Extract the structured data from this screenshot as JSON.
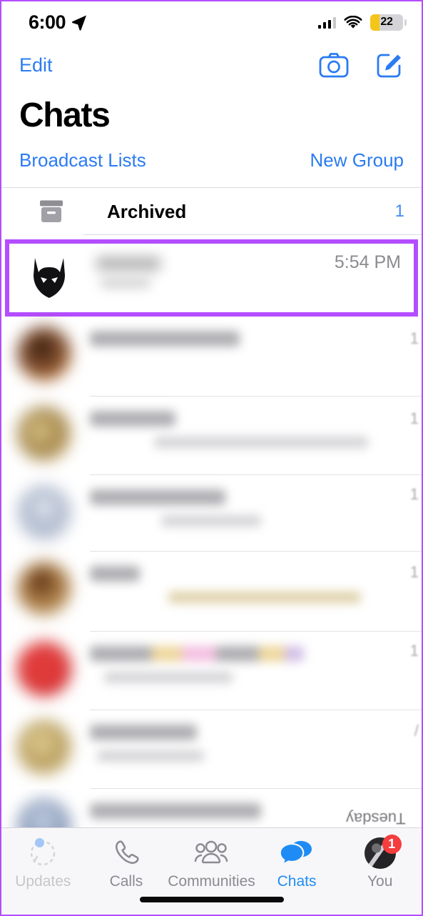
{
  "status_bar": {
    "time": "6:00",
    "location_icon": "location-arrow-icon",
    "signal_icon": "cellular-signal-icon",
    "wifi_icon": "wifi-icon",
    "battery_percent": "22",
    "battery_icon": "battery-low-power-icon"
  },
  "nav": {
    "edit_label": "Edit",
    "camera_icon": "camera-icon",
    "compose_icon": "compose-new-chat-icon"
  },
  "header": {
    "title": "Chats",
    "broadcast_lists_label": "Broadcast Lists",
    "new_group_label": "New Group"
  },
  "archived": {
    "icon": "archive-box-icon",
    "label": "Archived",
    "count": "1"
  },
  "highlighted_chat": {
    "avatar_icon": "batman-mask-avatar",
    "name": "",
    "message_preview": "",
    "timestamp": "5:54 PM",
    "highlight_color": "#b44dff"
  },
  "chat_rows": [
    {
      "avatar_color": "#7a4a2c",
      "name_width": 210,
      "line_widths": [
        0
      ],
      "badge": "1",
      "blurred": true
    },
    {
      "avatar_color": "#b79a62",
      "name_width": 120,
      "line_widths": [
        300
      ],
      "badge": "1",
      "blurred": true
    },
    {
      "avatar_color": "#a9b3c6",
      "name_width": 190,
      "line_widths": [
        140
      ],
      "badge": "1",
      "blurred": true
    },
    {
      "avatar_color": "#8a6038",
      "name_width": 70,
      "line_widths": [
        270
      ],
      "badge": "1",
      "blurred": true
    },
    {
      "avatar_color": "#d62b2b",
      "name_width": 300,
      "line_widths": [
        180
      ],
      "badge": "1",
      "blurred": true
    },
    {
      "avatar_color": "#c6ab6e",
      "name_width": 150,
      "line_widths": [
        150
      ],
      "badge": "",
      "blurred": true
    },
    {
      "avatar_color": "#8fa0bd",
      "name_width": 240,
      "line_widths": [
        0
      ],
      "badge": "",
      "blurred": true
    }
  ],
  "artifact_text": "Tuesday",
  "tab_bar": {
    "tabs": [
      {
        "label": "Updates",
        "icon": "updates-status-ring-icon",
        "active": false,
        "badge_dot": true
      },
      {
        "label": "Calls",
        "icon": "phone-icon",
        "active": false,
        "badge_dot": false
      },
      {
        "label": "Communities",
        "icon": "communities-people-icon",
        "active": false,
        "badge_dot": false
      },
      {
        "label": "Chats",
        "icon": "chat-bubbles-icon",
        "active": true,
        "badge_dot": false
      },
      {
        "label": "You",
        "icon": "profile-avatar-icon",
        "active": false,
        "badge_count": "1"
      }
    ],
    "active_color": "#1f8cf5",
    "inactive_color": "#8b8b90"
  },
  "colors": {
    "ios_blue": "#2b7bf3",
    "highlight_purple": "#b44dff",
    "badge_red": "#f53d3d",
    "battery_yellow": "#f5c518"
  }
}
